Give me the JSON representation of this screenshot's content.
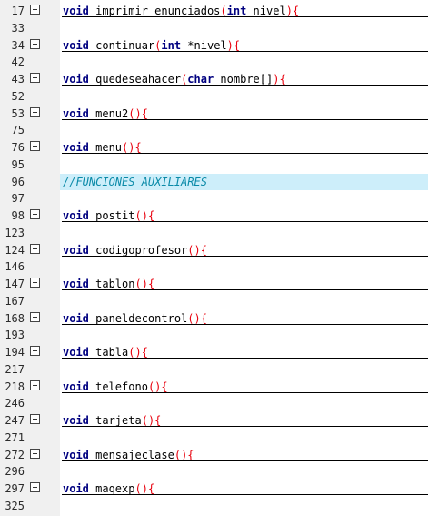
{
  "editor": {
    "lines": [
      {
        "num": "17",
        "folded": true,
        "kw": "void",
        "name": " imprimir_enunciados",
        "open": "(",
        "args_kw": "int",
        "args_rest": " nivel",
        "close": "){"
      },
      {
        "num": "33"
      },
      {
        "num": "34",
        "folded": true,
        "kw": "void",
        "name": " continuar",
        "open": "(",
        "args_kw": "int",
        "args_rest": " *nivel",
        "close": "){"
      },
      {
        "num": "42"
      },
      {
        "num": "43",
        "folded": true,
        "kw": "void",
        "name": " quedeseahacer",
        "open": "(",
        "args_kw": "char",
        "args_rest": " nombre[]",
        "close": "){"
      },
      {
        "num": "52"
      },
      {
        "num": "53",
        "folded": true,
        "kw": "void",
        "name": " menu2",
        "open": "(",
        "args_kw": "",
        "args_rest": "",
        "close": "){"
      },
      {
        "num": "75"
      },
      {
        "num": "76",
        "folded": true,
        "kw": "void",
        "name": " menu",
        "open": "(",
        "args_kw": "",
        "args_rest": "",
        "close": "){"
      },
      {
        "num": "95"
      },
      {
        "num": "96",
        "comment": "//FUNCIONES AUXILIARES"
      },
      {
        "num": "97"
      },
      {
        "num": "98",
        "folded": true,
        "kw": "void",
        "name": " postit",
        "open": "(",
        "args_kw": "",
        "args_rest": "",
        "close": "){"
      },
      {
        "num": "123"
      },
      {
        "num": "124",
        "folded": true,
        "kw": "void",
        "name": " codigoprofesor",
        "open": "(",
        "args_kw": "",
        "args_rest": "",
        "close": "){"
      },
      {
        "num": "146"
      },
      {
        "num": "147",
        "folded": true,
        "kw": "void",
        "name": " tablon",
        "open": "(",
        "args_kw": "",
        "args_rest": "",
        "close": "){"
      },
      {
        "num": "167"
      },
      {
        "num": "168",
        "folded": true,
        "kw": "void",
        "name": " paneldecontrol",
        "open": "(",
        "args_kw": "",
        "args_rest": "",
        "close": "){"
      },
      {
        "num": "193"
      },
      {
        "num": "194",
        "folded": true,
        "kw": "void",
        "name": " tabla",
        "open": "(",
        "args_kw": "",
        "args_rest": "",
        "close": "){"
      },
      {
        "num": "217"
      },
      {
        "num": "218",
        "folded": true,
        "kw": "void",
        "name": " telefono",
        "open": "(",
        "args_kw": "",
        "args_rest": "",
        "close": "){"
      },
      {
        "num": "246"
      },
      {
        "num": "247",
        "folded": true,
        "kw": "void",
        "name": " tarjeta",
        "open": "(",
        "args_kw": "",
        "args_rest": "",
        "close": "){"
      },
      {
        "num": "271"
      },
      {
        "num": "272",
        "folded": true,
        "kw": "void",
        "name": " mensajeclase",
        "open": "(",
        "args_kw": "",
        "args_rest": "",
        "close": "){"
      },
      {
        "num": "296"
      },
      {
        "num": "297",
        "folded": true,
        "kw": "void",
        "name": " maqexp",
        "open": "(",
        "args_kw": "",
        "args_rest": "",
        "close": "){"
      },
      {
        "num": "325"
      }
    ]
  }
}
